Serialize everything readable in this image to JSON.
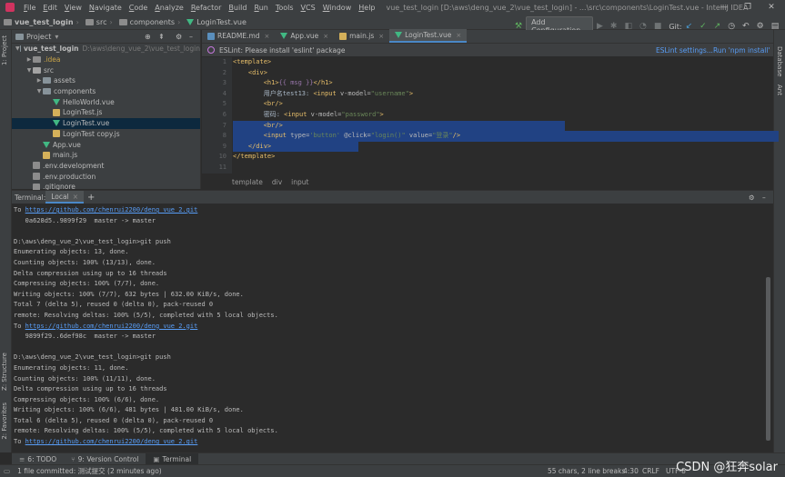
{
  "menu": [
    "File",
    "Edit",
    "View",
    "Navigate",
    "Code",
    "Analyze",
    "Refactor",
    "Build",
    "Run",
    "Tools",
    "VCS",
    "Window",
    "Help"
  ],
  "window_title": "vue_test_login [D:\\aws\\deng_vue_2\\vue_test_login] - ...\\src\\components\\LoginTest.vue - IntelliJ IDEA",
  "window_controls": [
    "—",
    "❐",
    "✕"
  ],
  "navbar": {
    "crumbs": [
      "vue_test_login",
      "src",
      "components",
      "LoginTest.vue"
    ],
    "add_config": "Add Configuration...",
    "git_label": "Git:"
  },
  "left_stripe": {
    "project": "1: Project",
    "structure": "Z: Structure",
    "favorites": "2: Favorites"
  },
  "right_stripe": {
    "database": "Database",
    "ant": "Ant"
  },
  "project": {
    "title": "Project",
    "tree": [
      {
        "name": "vue_test_login",
        "extra": "D:\\aws\\deng_vue_2\\vue_test_login",
        "depth": 0,
        "arrow": "▼",
        "type": "folder"
      },
      {
        "name": ".idea",
        "extra": "",
        "depth": 1,
        "arrow": "▶",
        "type": "idea"
      },
      {
        "name": "src",
        "extra": "",
        "depth": 1,
        "arrow": "▼",
        "type": "src"
      },
      {
        "name": "assets",
        "extra": "",
        "depth": 2,
        "arrow": "▶",
        "type": "folder"
      },
      {
        "name": "components",
        "extra": "",
        "depth": 2,
        "arrow": "▼",
        "type": "folder"
      },
      {
        "name": "HelloWorld.vue",
        "extra": "",
        "depth": 3,
        "arrow": "",
        "type": "vue"
      },
      {
        "name": "LoginTest.js",
        "extra": "",
        "depth": 3,
        "arrow": "",
        "type": "js"
      },
      {
        "name": "LoginTest.vue",
        "extra": "",
        "depth": 3,
        "arrow": "",
        "type": "vue",
        "selected": true
      },
      {
        "name": "LoginTest copy.js",
        "extra": "",
        "depth": 3,
        "arrow": "",
        "type": "js"
      },
      {
        "name": "App.vue",
        "extra": "",
        "depth": 2,
        "arrow": "",
        "type": "vue"
      },
      {
        "name": "main.js",
        "extra": "",
        "depth": 2,
        "arrow": "",
        "type": "js"
      },
      {
        "name": ".env.development",
        "extra": "",
        "depth": 1,
        "arrow": "",
        "type": "file"
      },
      {
        "name": ".env.production",
        "extra": "",
        "depth": 1,
        "arrow": "",
        "type": "file"
      },
      {
        "name": ".gitignore",
        "extra": "",
        "depth": 1,
        "arrow": "",
        "type": "file"
      }
    ]
  },
  "editor": {
    "tabs": [
      {
        "label": "README.md",
        "type": "md"
      },
      {
        "label": "App.vue",
        "type": "vue"
      },
      {
        "label": "main.js",
        "type": "js"
      },
      {
        "label": "LoginTest.vue",
        "type": "vue",
        "active": true
      }
    ],
    "eslint": {
      "message": "ESLint: Please install 'eslint' package",
      "settings": "ESLint settings...",
      "run": "Run 'npm install'"
    },
    "line_numbers": [
      "1",
      "2",
      "3",
      "4",
      "5",
      "6",
      "7",
      "8",
      "9",
      "10",
      "11"
    ],
    "breadcrumbs": [
      "template",
      "div",
      "input"
    ]
  },
  "terminal": {
    "label": "Terminal:",
    "tab": "Local",
    "lines": [
      {
        "pre": "To ",
        "link": "https://github.com/chenrui2200/deng_vue_2.git",
        "post": ""
      },
      {
        "pre": "   0a628d5..9899f29  master -> master",
        "link": "",
        "post": ""
      },
      {
        "pre": "",
        "link": "",
        "post": ""
      },
      {
        "pre": "D:\\aws\\deng_vue_2\\vue_test_login>git push",
        "link": "",
        "post": ""
      },
      {
        "pre": "Enumerating objects: 13, done.",
        "link": "",
        "post": ""
      },
      {
        "pre": "Counting objects: 100% (13/13), done.",
        "link": "",
        "post": ""
      },
      {
        "pre": "Delta compression using up to 16 threads",
        "link": "",
        "post": ""
      },
      {
        "pre": "Compressing objects: 100% (7/7), done.",
        "link": "",
        "post": ""
      },
      {
        "pre": "Writing objects: 100% (7/7), 632 bytes | 632.00 KiB/s, done.",
        "link": "",
        "post": ""
      },
      {
        "pre": "Total 7 (delta 5), reused 0 (delta 0), pack-reused 0",
        "link": "",
        "post": ""
      },
      {
        "pre": "remote: Resolving deltas: 100% (5/5), completed with 5 local objects.",
        "link": "",
        "post": ""
      },
      {
        "pre": "To ",
        "link": "https://github.com/chenrui2200/deng_vue_2.git",
        "post": ""
      },
      {
        "pre": "   9899f29..6def98c  master -> master",
        "link": "",
        "post": ""
      },
      {
        "pre": "",
        "link": "",
        "post": ""
      },
      {
        "pre": "D:\\aws\\deng_vue_2\\vue_test_login>git push",
        "link": "",
        "post": ""
      },
      {
        "pre": "Enumerating objects: 11, done.",
        "link": "",
        "post": ""
      },
      {
        "pre": "Counting objects: 100% (11/11), done.",
        "link": "",
        "post": ""
      },
      {
        "pre": "Delta compression using up to 16 threads",
        "link": "",
        "post": ""
      },
      {
        "pre": "Compressing objects: 100% (6/6), done.",
        "link": "",
        "post": ""
      },
      {
        "pre": "Writing objects: 100% (6/6), 481 bytes | 481.00 KiB/s, done.",
        "link": "",
        "post": ""
      },
      {
        "pre": "Total 6 (delta 5), reused 0 (delta 0), pack-reused 0",
        "link": "",
        "post": ""
      },
      {
        "pre": "remote: Resolving deltas: 100% (5/5), completed with 5 local objects.",
        "link": "",
        "post": ""
      },
      {
        "pre": "To ",
        "link": "https://github.com/chenrui2200/deng_vue_2.git",
        "post": ""
      }
    ]
  },
  "tool_tabs": [
    {
      "label": "6: TODO",
      "icon": "≡"
    },
    {
      "label": "9: Version Control",
      "icon": "⑂"
    },
    {
      "label": "Terminal",
      "icon": "▣",
      "active": true
    }
  ],
  "status": {
    "message": "1 file committed: 测试提交 (2 minutes ago)",
    "selection": "55 chars, 2 line breaks",
    "position": "4:30",
    "line_sep": "CRLF",
    "encoding": "UTF-8"
  },
  "watermark": "CSDN @狂奔solar"
}
